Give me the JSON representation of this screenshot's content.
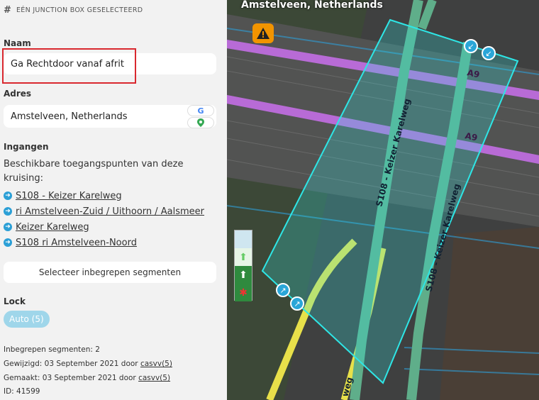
{
  "panel": {
    "header": "EÉN JUNCTION BOX GESELECTEERD",
    "name_label": "Naam",
    "name_value": "Ga Rechtdoor vanaf afrit",
    "address_label": "Adres",
    "address_value": "Amstelveen, Netherlands",
    "entries_label": "Ingangen",
    "entries_desc": "Beschikbare toegangspunten van deze kruising:",
    "entries": [
      "S108 - Keizer Karelweg",
      "ri Amstelveen-Zuid / Uithoorn / Aalsmeer",
      "Keizer Karelweg",
      "S108 ri Amstelveen-Noord"
    ],
    "select_segments_button": "Selecteer inbegrepen segmenten",
    "lock_label": "Lock",
    "lock_value": "Auto (5)",
    "meta": {
      "segments": "Inbegrepen segmenten: 2",
      "modified_prefix": "Gewijzigd: 03 September 2021 door",
      "modified_user": "casvv(5)",
      "created_prefix": "Gemaakt: 03 September 2021 door",
      "created_user": "casvv(5)",
      "id": "ID: 41599"
    }
  },
  "map": {
    "title": "Amstelveen, Netherlands",
    "road_labels": [
      "S108 - Keizer Karelweg",
      "S108 - Keizer Karelweg",
      "A9",
      "A9"
    ],
    "road_label_partial": "weg",
    "colors": {
      "highway": "#b86bd6",
      "street": "#5fae8a",
      "yellow": "#e8e04a",
      "selection": "#2ee6e6"
    }
  }
}
